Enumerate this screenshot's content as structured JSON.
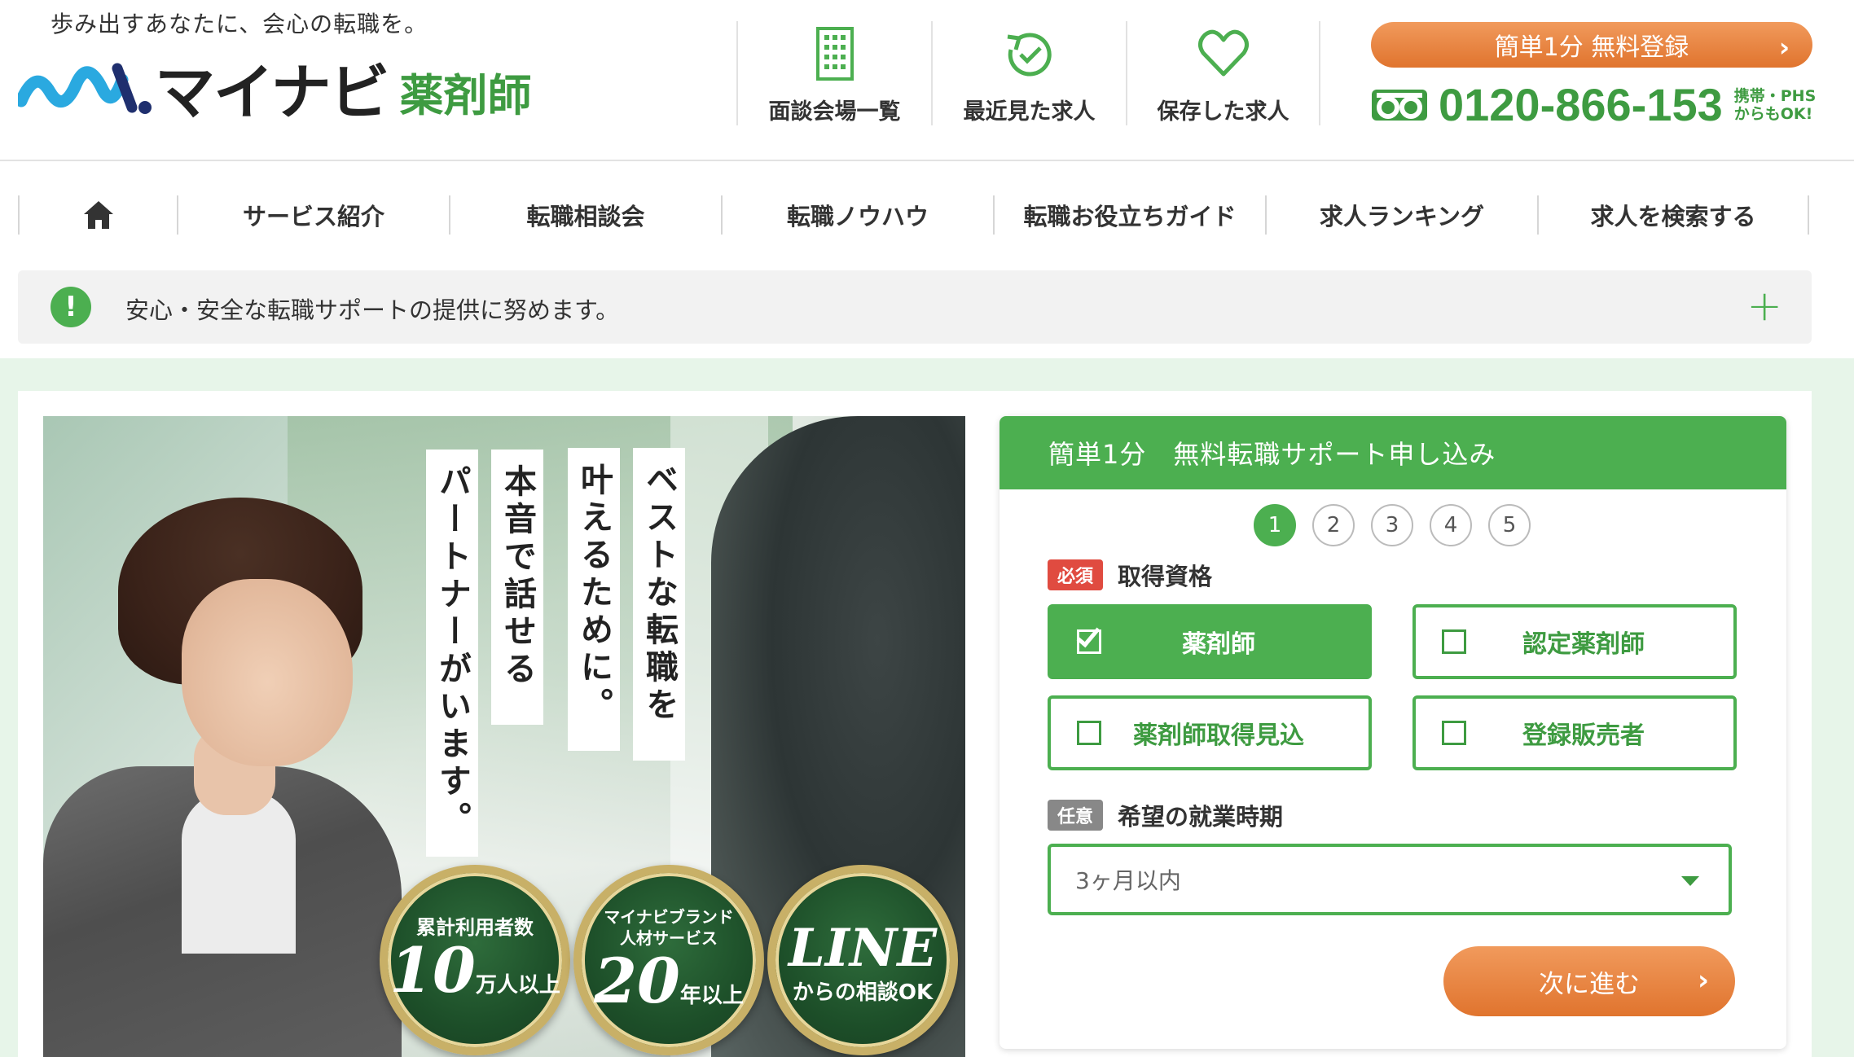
{
  "header": {
    "tagline": "歩み出すあなたに、会心の転職を。",
    "logo_text": "マイナビ",
    "logo_sub": "薬剤師",
    "nav": [
      {
        "label": "面談会場一覧",
        "icon": "building-icon"
      },
      {
        "label": "最近見た求人",
        "icon": "history-clock-icon"
      },
      {
        "label": "保存した求人",
        "icon": "heart-icon"
      }
    ],
    "register_label": "簡単1分 無料登録",
    "phone_number": "0120-866-153",
    "phone_note_1": "携帯・PHS",
    "phone_note_2": "からもOK!"
  },
  "main_nav": [
    {
      "label": ""
    },
    {
      "label": "サービス紹介"
    },
    {
      "label": "転職相談会"
    },
    {
      "label": "転職ノウハウ"
    },
    {
      "label": "転職お役立ちガイド"
    },
    {
      "label": "求人ランキング"
    },
    {
      "label": "求人を検索する"
    }
  ],
  "notice": {
    "text": "安心・安全な転職サポートの提供に努めます。"
  },
  "hero": {
    "copy": [
      "ベストな転職を",
      "叶えるために。",
      "本音で話せる",
      "パートナーがいます。"
    ],
    "medals": [
      {
        "top": "累計利用者数",
        "big": "10",
        "unit": "万人以上"
      },
      {
        "top": "マイナビブランド人材サービス",
        "big": "20",
        "unit": "年以上"
      },
      {
        "big": "LINE",
        "sub": "からの相談OK"
      }
    ]
  },
  "form": {
    "title": "簡単1分　無料転職サポート申し込み",
    "steps": [
      "1",
      "2",
      "3",
      "4",
      "5"
    ],
    "active_step": 1,
    "qualification": {
      "badge": "必須",
      "label": "取得資格",
      "options": [
        {
          "label": "薬剤師",
          "checked": true
        },
        {
          "label": "認定薬剤師",
          "checked": false
        },
        {
          "label": "薬剤師取得見込",
          "checked": false
        },
        {
          "label": "登録販売者",
          "checked": false
        }
      ]
    },
    "period": {
      "badge": "任意",
      "label": "希望の就業時期",
      "selected": "3ヶ月以内"
    },
    "next_label": "次に進む"
  },
  "colors": {
    "brand_green": "#4caf50",
    "accent_orange": "#e0742e",
    "required_red": "#e04b40"
  }
}
